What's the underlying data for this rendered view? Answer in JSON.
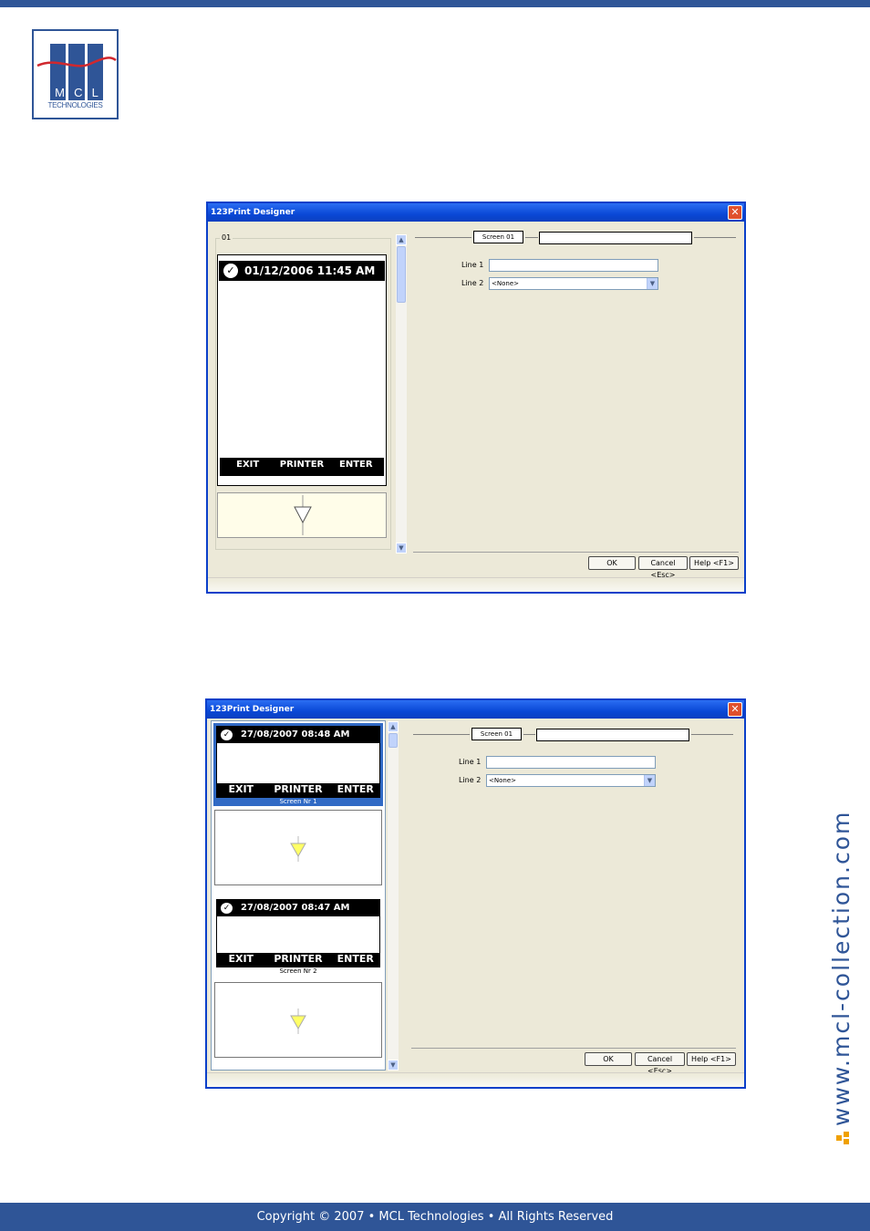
{
  "footer": {
    "copyright": "Copyright © 2007 • MCL Technologies • All Rights Reserved"
  },
  "logo": {
    "letters": [
      "M",
      "C",
      "L"
    ],
    "subtitle": "TECHNOLOGIES"
  },
  "side_url": "www.mcl-collection.com",
  "colors": {
    "brand_blue": "#2f5597",
    "accent_orange": "#f0a000",
    "xp_title_blue": "#0a48d6",
    "xp_face": "#ece9d8"
  },
  "window1": {
    "title": "123Print Designer",
    "group_label": "01",
    "preview": {
      "datetime": "01/12/2006 11:45 AM",
      "softkeys": [
        "EXIT",
        "PRINTER",
        "ENTER"
      ]
    },
    "screen_tab": "Screen 01",
    "screen_name_value": "",
    "line1_label": "Line 1",
    "line1_value": "",
    "line2_label": "Line 2",
    "line2_value": "<None>",
    "buttons": {
      "ok": "OK",
      "cancel": "Cancel <Esc>",
      "help": "Help <F1>"
    }
  },
  "window2": {
    "title": "123Print Designer",
    "screens": [
      {
        "datetime": "27/08/2007 08:48 AM",
        "softkeys": [
          "EXIT",
          "PRINTER",
          "ENTER"
        ],
        "caption": "Screen Nr 1"
      },
      {
        "datetime": "27/08/2007 08:47 AM",
        "softkeys": [
          "EXIT",
          "PRINTER",
          "ENTER"
        ],
        "caption": "Screen Nr 2"
      }
    ],
    "screen_tab": "Screen 01",
    "screen_name_value": "",
    "line1_label": "Line 1",
    "line1_value": "",
    "line2_label": "Line 2",
    "line2_value": "<None>",
    "buttons": {
      "ok": "OK",
      "cancel": "Cancel <Esc>",
      "help": "Help <F1>"
    }
  }
}
